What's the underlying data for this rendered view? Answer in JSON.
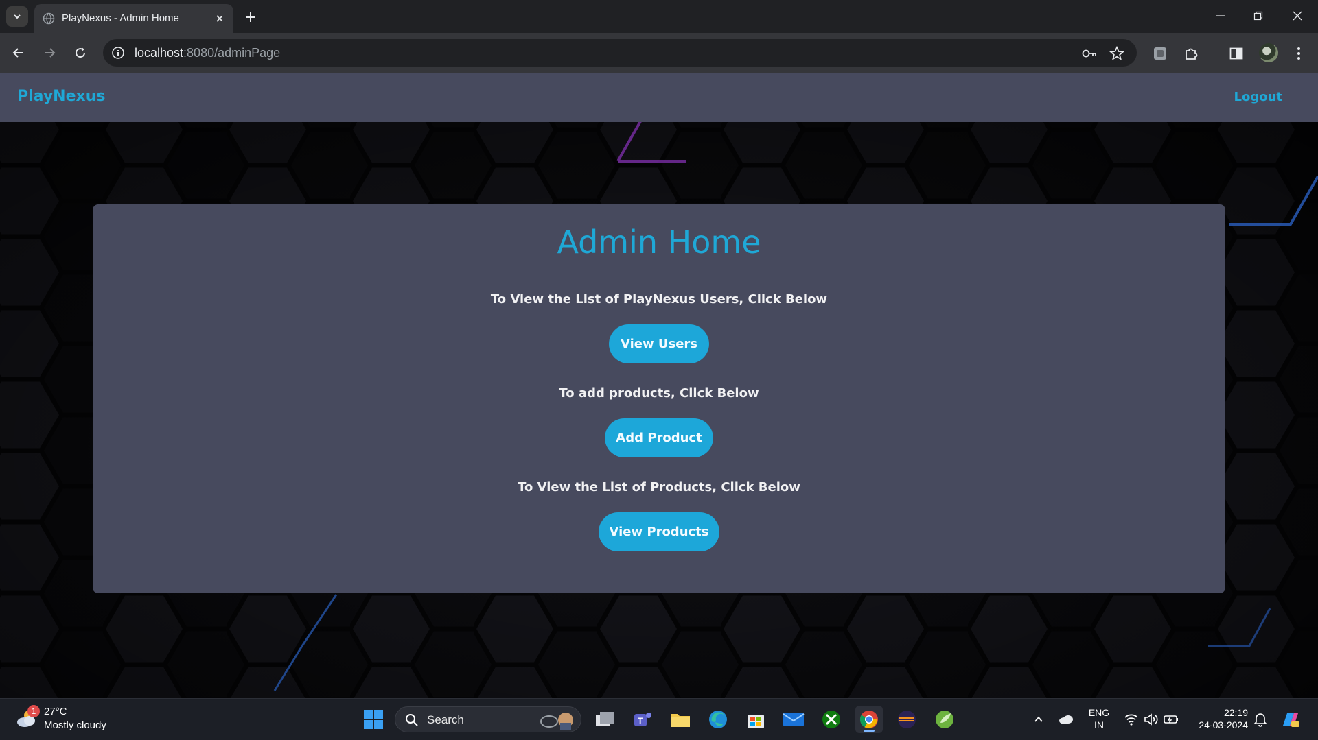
{
  "browser": {
    "tab_title": "PlayNexus - Admin Home",
    "url_host": "localhost",
    "url_path": ":8080/adminPage"
  },
  "navbar": {
    "brand": "PlayNexus",
    "logout_label": "Logout"
  },
  "card": {
    "title": "Admin Home",
    "sections": [
      {
        "prompt": "To View the List of PlayNexus Users, Click Below",
        "button": "View Users"
      },
      {
        "prompt": "To add products, Click Below",
        "button": "Add Product"
      },
      {
        "prompt": "To View the List of Products, Click Below",
        "button": "View Products"
      }
    ]
  },
  "taskbar": {
    "weather_temp": "27°C",
    "weather_desc": "Mostly cloudy",
    "weather_badge": "1",
    "search_label": "Search",
    "lang_line1": "ENG",
    "lang_line2": "IN",
    "time": "22:19",
    "date": "24-03-2024"
  },
  "colors": {
    "accent": "#1fa8d6",
    "panel": "#474a5e",
    "button": "#1da7d9"
  }
}
